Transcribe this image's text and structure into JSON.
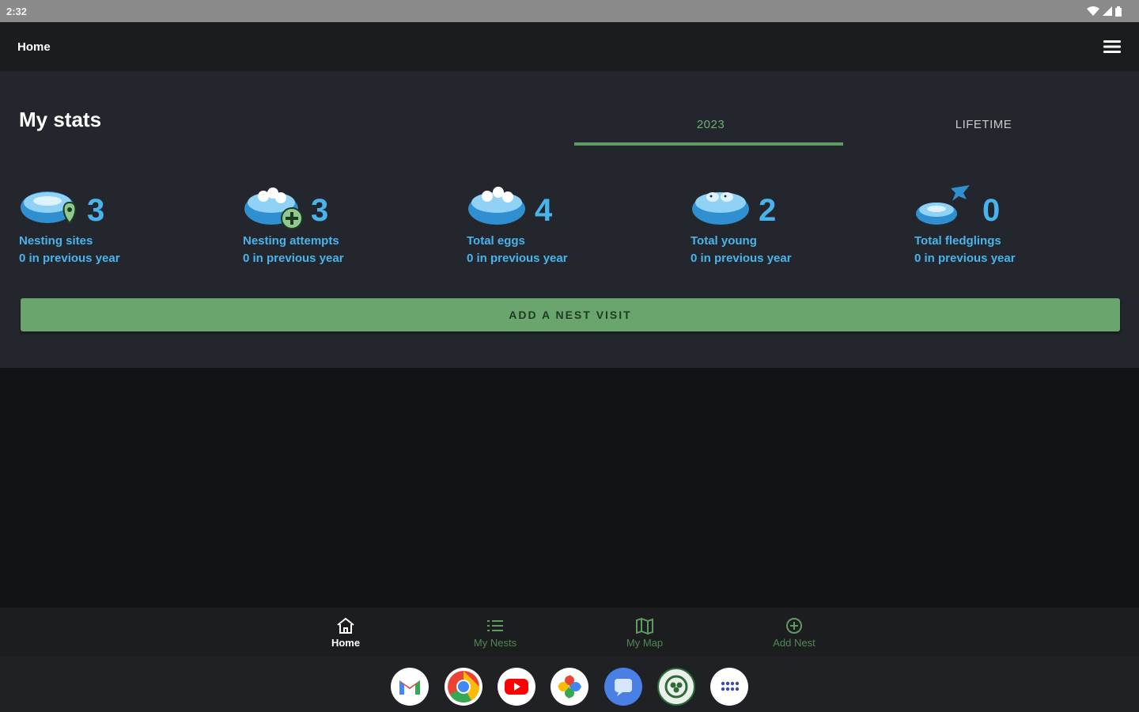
{
  "status_bar": {
    "time": "2:32"
  },
  "app_bar": {
    "title": "Home"
  },
  "stats": {
    "title": "My stats",
    "tabs": [
      {
        "label": "2023",
        "active": true
      },
      {
        "label": "LIFETIME",
        "active": false
      }
    ],
    "items": [
      {
        "value": "3",
        "label": "Nesting sites",
        "previous": "0 in previous year",
        "icon": "nest-location-icon"
      },
      {
        "value": "3",
        "label": "Nesting attempts",
        "previous": "0 in previous year",
        "icon": "nest-add-eggs-icon"
      },
      {
        "value": "4",
        "label": "Total eggs",
        "previous": "0 in previous year",
        "icon": "nest-eggs-icon"
      },
      {
        "value": "2",
        "label": "Total young",
        "previous": "0 in previous year",
        "icon": "nest-young-icon"
      },
      {
        "value": "0",
        "label": "Total fledglings",
        "previous": "0 in previous year",
        "icon": "nest-fledgling-icon"
      }
    ],
    "add_visit_label": "ADD A NEST VISIT"
  },
  "bottom_nav": [
    {
      "label": "Home",
      "icon": "home-icon",
      "active": true
    },
    {
      "label": "My Nests",
      "icon": "list-icon",
      "active": false
    },
    {
      "label": "My Map",
      "icon": "map-icon",
      "active": false
    },
    {
      "label": "Add Nest",
      "icon": "add-circle-icon",
      "active": false
    }
  ],
  "dock_apps": [
    "gmail-icon",
    "chrome-icon",
    "youtube-icon",
    "photos-icon",
    "messages-icon",
    "nestwatch-icon",
    "app-drawer-icon"
  ],
  "colors": {
    "accent_green": "#6aa56e",
    "stat_blue": "#48b4ec",
    "panel_bg": "#23272d"
  }
}
